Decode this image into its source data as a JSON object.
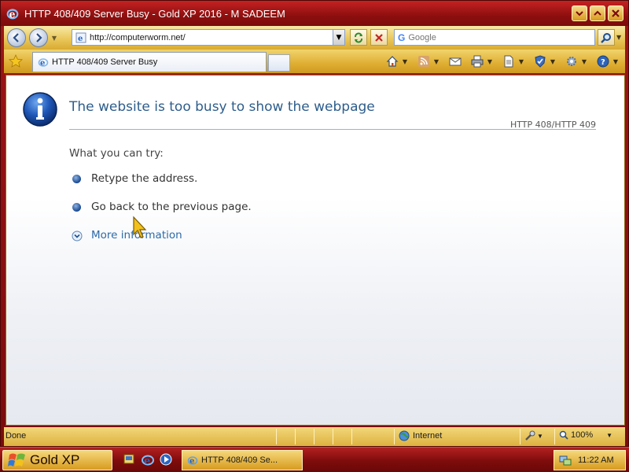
{
  "window": {
    "title": "HTTP 408/409 Server Busy - Gold XP 2016 - M SADEEM"
  },
  "addressbar": {
    "url": "http://computerworm.net/",
    "search_placeholder": "Google"
  },
  "tabs": [
    {
      "label": "HTTP 408/409 Server Busy"
    }
  ],
  "error_page": {
    "title": "The website is too busy to show the webpage",
    "code": "HTTP 408/HTTP 409",
    "try_label": "What you can try:",
    "suggestions": [
      "Retype the address.",
      "Go back to the previous page."
    ],
    "more_info": "More information"
  },
  "statusbar": {
    "status": "Done",
    "zone": "Internet",
    "zoom": "100%"
  },
  "taskbar": {
    "start_label": "Gold XP",
    "task_label": "HTTP 408/409 Se...",
    "clock": "11:22 AM"
  },
  "colors": {
    "frame": "#8d0f0f",
    "toolbar": "#e9c75a",
    "title_text": "#2d5d8c",
    "link": "#2c6aa8"
  }
}
